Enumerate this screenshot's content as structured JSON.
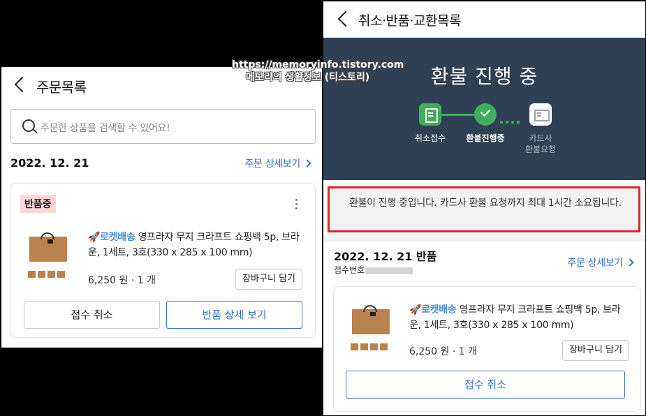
{
  "left": {
    "title": "주문목록",
    "search": {
      "placeholder": "주문한 상품을 검색할 수 있어요!"
    },
    "date": "2022. 12. 21",
    "detail_link": "주문 상세보기",
    "card": {
      "status_badge": "반품중",
      "product": {
        "badge": "🚀로켓배송",
        "name": " 영프라자 무지 크라프트 쇼핑백 5p, 브라운, 1세트, 3호(330 x 285 x 100 mm)"
      },
      "price": "6,250 원 · 1 개",
      "cart_button": "장바구니 담기",
      "cancel_button": "접수 취소",
      "return_detail_button": "반품 상세 보기"
    }
  },
  "right": {
    "title": "취소·반품·교환목록",
    "banner": {
      "title": "환불 진행 중",
      "steps": [
        {
          "label": "취소접수",
          "state": "done",
          "icon": "document-icon"
        },
        {
          "label": "환불진행중",
          "state": "current",
          "icon": "check-icon"
        },
        {
          "label": "카드사\n환불요청",
          "state": "pending",
          "icon": "card-icon"
        }
      ]
    },
    "notice": "환불이 진행 중입니다. 카드사 환불 요청까지 최대 1시간 소요됩니다.",
    "date": "2022. 12. 21 반품",
    "receipt_label": "접수번호",
    "detail_link": "주문 상세보기",
    "card": {
      "product": {
        "badge": "🚀로켓배송",
        "name": " 영프라자 무지 크라프트 쇼핑백 5p, 브라운, 1세트, 3호(330 x 285 x 100 mm)"
      },
      "price": "6,250 원 · 1 개",
      "cart_button": "장바구니 담기",
      "cancel_button": "접수 취소"
    }
  },
  "watermark": {
    "url": "https://memoryinfo.tistory.com",
    "name": "메모리의 생활정보 (티스토리)"
  },
  "colors": {
    "accent_blue": "#3a6fc4",
    "banner": "#2f4054",
    "step_green": "#3fae5c",
    "highlight_red": "#e02424",
    "badge_pink": "#fcd7d7"
  }
}
